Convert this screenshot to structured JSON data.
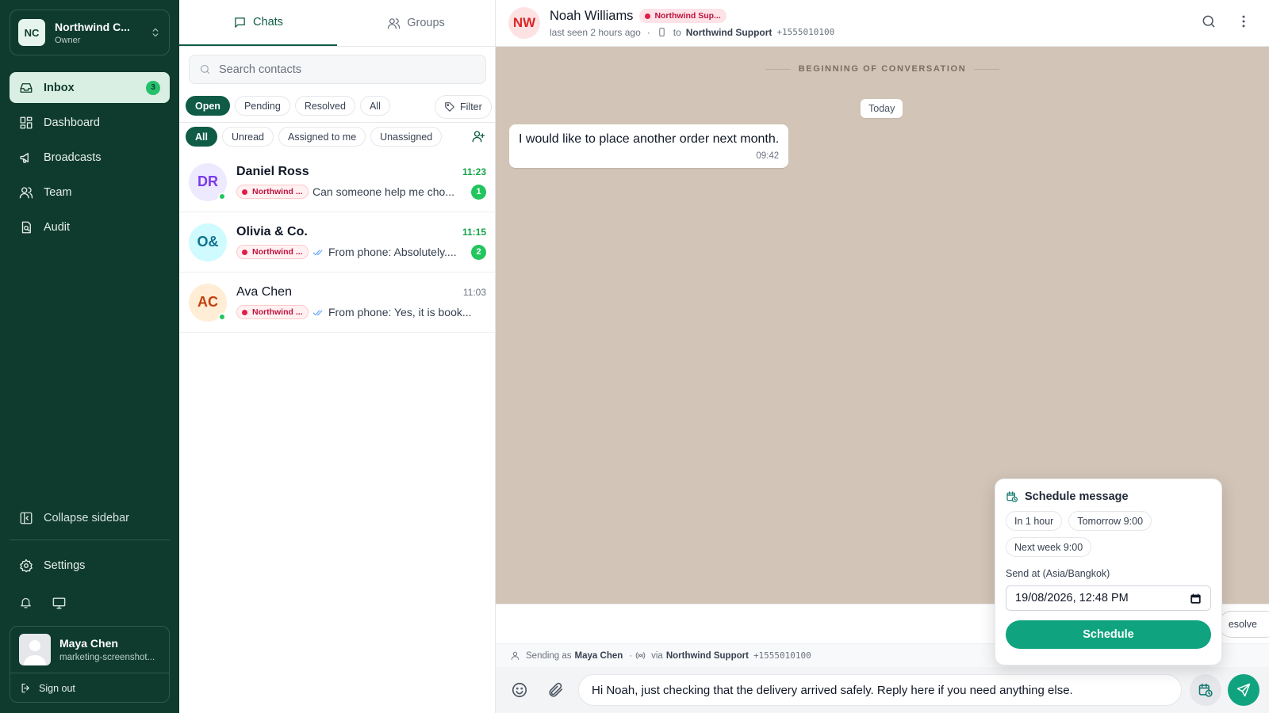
{
  "workspace": {
    "initials": "NC",
    "name": "Northwind C...",
    "role": "Owner"
  },
  "nav": {
    "items": [
      {
        "label": "Inbox",
        "icon": "inbox-icon",
        "badge": "3",
        "active": true
      },
      {
        "label": "Dashboard",
        "icon": "dashboard-icon"
      },
      {
        "label": "Broadcasts",
        "icon": "megaphone-icon"
      },
      {
        "label": "Team",
        "icon": "team-icon"
      },
      {
        "label": "Audit",
        "icon": "audit-icon"
      }
    ],
    "collapse_label": "Collapse sidebar",
    "settings_label": "Settings"
  },
  "user": {
    "name": "Maya Chen",
    "email": "marketing-screenshot...",
    "signout_label": "Sign out"
  },
  "list": {
    "tabs": [
      {
        "label": "Chats",
        "active": true
      },
      {
        "label": "Groups"
      }
    ],
    "search_placeholder": "Search contacts",
    "status_chips": [
      "Open",
      "Pending",
      "Resolved",
      "All"
    ],
    "filter_label": "Filter",
    "assign_chips": [
      "All",
      "Unread",
      "Assigned to me",
      "Unassigned"
    ],
    "conversations": [
      {
        "initials": "DR",
        "name": "Daniel Ross",
        "time": "11:23",
        "tag": "Northwind ...",
        "preview": "Can someone help me cho...",
        "unread": "1",
        "online": true,
        "bold": true,
        "ticks": false,
        "av_bg": "#ede9fe",
        "av_fg": "#7c3aed"
      },
      {
        "initials": "O&",
        "name": "Olivia & Co.",
        "time": "11:15",
        "tag": "Northwind ...",
        "preview": "From phone: Absolutely....",
        "unread": "2",
        "online": false,
        "bold": true,
        "ticks": true,
        "av_bg": "#cffafe",
        "av_fg": "#0e7490"
      },
      {
        "initials": "AC",
        "name": "Ava Chen",
        "time": "11:03",
        "tag": "Northwind ...",
        "preview": "From phone: Yes, it is book...",
        "unread": "",
        "online": true,
        "bold": false,
        "ticks": true,
        "av_bg": "#ffedd5",
        "av_fg": "#c2410c"
      }
    ]
  },
  "chat": {
    "contact_initials": "NW",
    "contact_name": "Noah Williams",
    "contact_tag": "Northwind Sup...",
    "last_seen": "last seen 2 hours ago",
    "to_label": "to",
    "channel_name": "Northwind Support",
    "channel_phone": "+1555010100",
    "beginning_label": "BEGINNING OF CONVERSATION",
    "date_label": "Today",
    "messages": [
      {
        "text": "I would like to place another order next month.",
        "time": "09:42"
      }
    ],
    "resolve_label": "esolve",
    "sending_prefix": "Sending as",
    "sending_user": "Maya Chen",
    "via_label": "via",
    "composer_text": "Hi Noah, just checking that the delivery arrived safely. Reply here if you need anything else."
  },
  "schedule": {
    "title": "Schedule message",
    "presets": [
      "In 1 hour",
      "Tomorrow 9:00",
      "Next week 9:00"
    ],
    "send_at_label": "Send at (Asia/Bangkok)",
    "datetime_value": "19/08/2026, 12:48 PM",
    "submit_label": "Schedule"
  },
  "colors": {
    "sidebar_bg": "#0f3b2e",
    "accent": "#10a37f",
    "tag_red": "#e11d48"
  }
}
